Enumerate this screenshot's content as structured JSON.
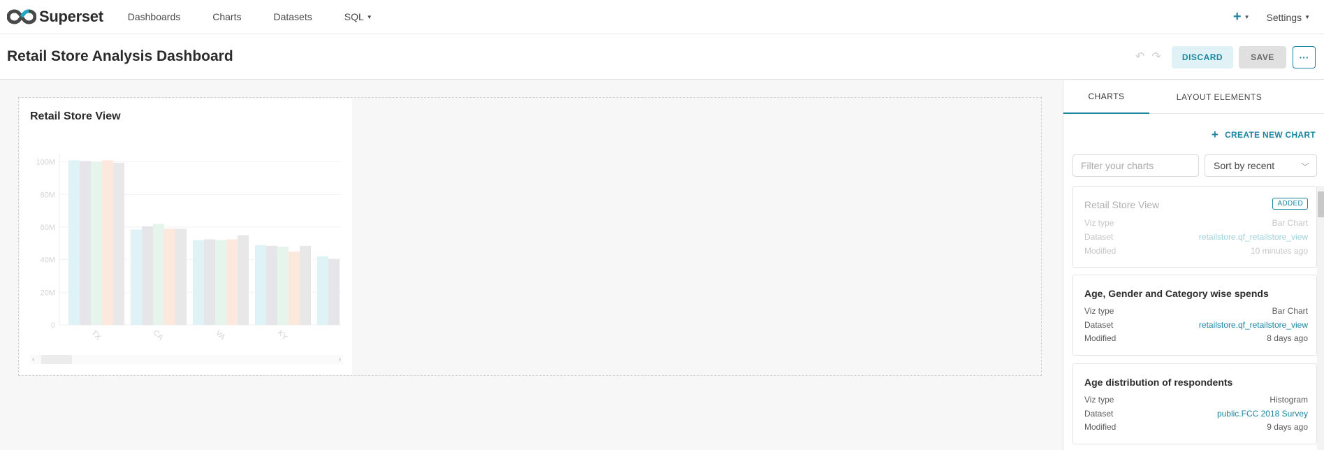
{
  "nav": {
    "brand": "Superset",
    "items": [
      {
        "label": "Dashboards",
        "has_caret": false
      },
      {
        "label": "Charts",
        "has_caret": false
      },
      {
        "label": "Datasets",
        "has_caret": false
      },
      {
        "label": "SQL",
        "has_caret": true
      }
    ],
    "plus_icon": "plus-icon",
    "settings_label": "Settings"
  },
  "header": {
    "title": "Retail Store Analysis Dashboard",
    "discard_label": "DISCARD",
    "save_label": "SAVE",
    "more_label": "···"
  },
  "chart": {
    "title": "Retail Store View"
  },
  "chart_data": {
    "type": "bar",
    "title": "Retail Store View",
    "xlabel": "",
    "ylabel": "",
    "categories": [
      "TX",
      "CA",
      "VA",
      "KY",
      ""
    ],
    "tick_labels_y": [
      "0",
      "20M",
      "40M",
      "60M",
      "80M",
      "100M"
    ],
    "ylim": [
      0,
      105000000
    ],
    "grid": true,
    "series": [
      {
        "color": "#dff3f7",
        "values": [
          101000000,
          58500000,
          52000000,
          49000000,
          42000000
        ]
      },
      {
        "color": "#e5e5ea",
        "values": [
          100500000,
          60500000,
          52500000,
          48500000,
          40500000
        ]
      },
      {
        "color": "#e5f5ec",
        "values": [
          100000000,
          62000000,
          52000000,
          48000000,
          41500000
        ]
      },
      {
        "color": "#fde8de",
        "values": [
          101000000,
          59000000,
          52500000,
          45000000,
          null
        ]
      },
      {
        "color": "#e8e8e8",
        "values": [
          99500000,
          59000000,
          55000000,
          48500000,
          null
        ]
      }
    ]
  },
  "sidebar": {
    "tabs": [
      "CHARTS",
      "LAYOUT ELEMENTS"
    ],
    "create_label": "CREATE NEW CHART",
    "filter_placeholder": "Filter your charts",
    "sort_value": "Sort by recent",
    "row_labels": {
      "viz": "Viz type",
      "dataset": "Dataset",
      "modified": "Modified"
    },
    "cards": [
      {
        "title": "Retail Store View",
        "added": true,
        "badge": "ADDED",
        "viz": "Bar Chart",
        "dataset": "retailstore.qf_retailstore_view",
        "modified": "10 minutes ago"
      },
      {
        "title": "Age, Gender and Category wise spends",
        "added": false,
        "badge": "",
        "viz": "Bar Chart",
        "dataset": "retailstore.qf_retailstore_view",
        "modified": "8 days ago"
      },
      {
        "title": "Age distribution of respondents",
        "added": false,
        "badge": "",
        "viz": "Histogram",
        "dataset": "public.FCC 2018 Survey",
        "modified": "9 days ago"
      }
    ]
  },
  "colors": {
    "accent": "#1a85a0"
  }
}
